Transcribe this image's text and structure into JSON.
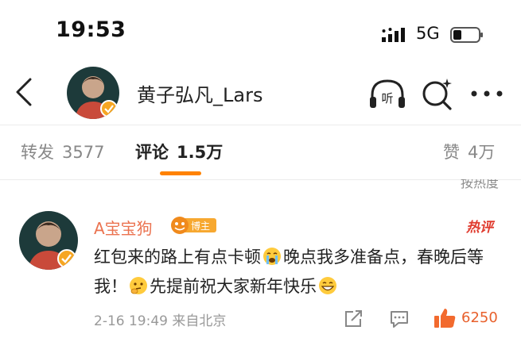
{
  "status_bar": {
    "time": "19:53",
    "network": "5G"
  },
  "header": {
    "title": "黄子弘凡_Lars"
  },
  "tabs": [
    {
      "name": "转发",
      "count": "3577"
    },
    {
      "name": "评论",
      "count": "1.5万"
    },
    {
      "name": "赞",
      "count": "4万"
    }
  ],
  "partial_text": "按热度",
  "comment": {
    "username": "A宝宝狗",
    "badge": "博主",
    "hot_label": "热评",
    "text_part1": "红包来的路上有点卡顿",
    "text_part2": "晚点我多准备点，春晚后等我！",
    "text_part3": "先提前祝大家新年快乐",
    "meta": "2-16 19:49  来自北京",
    "like_count": "6250"
  },
  "colors": {
    "accent": "#ff8200",
    "username": "#eb7350",
    "like": "#e8602c",
    "hot": "#e03b2e"
  },
  "icons": [
    "back-icon",
    "listen-icon",
    "search-icon",
    "more-icon",
    "share-icon",
    "reply-icon",
    "thumbs-up-icon"
  ]
}
